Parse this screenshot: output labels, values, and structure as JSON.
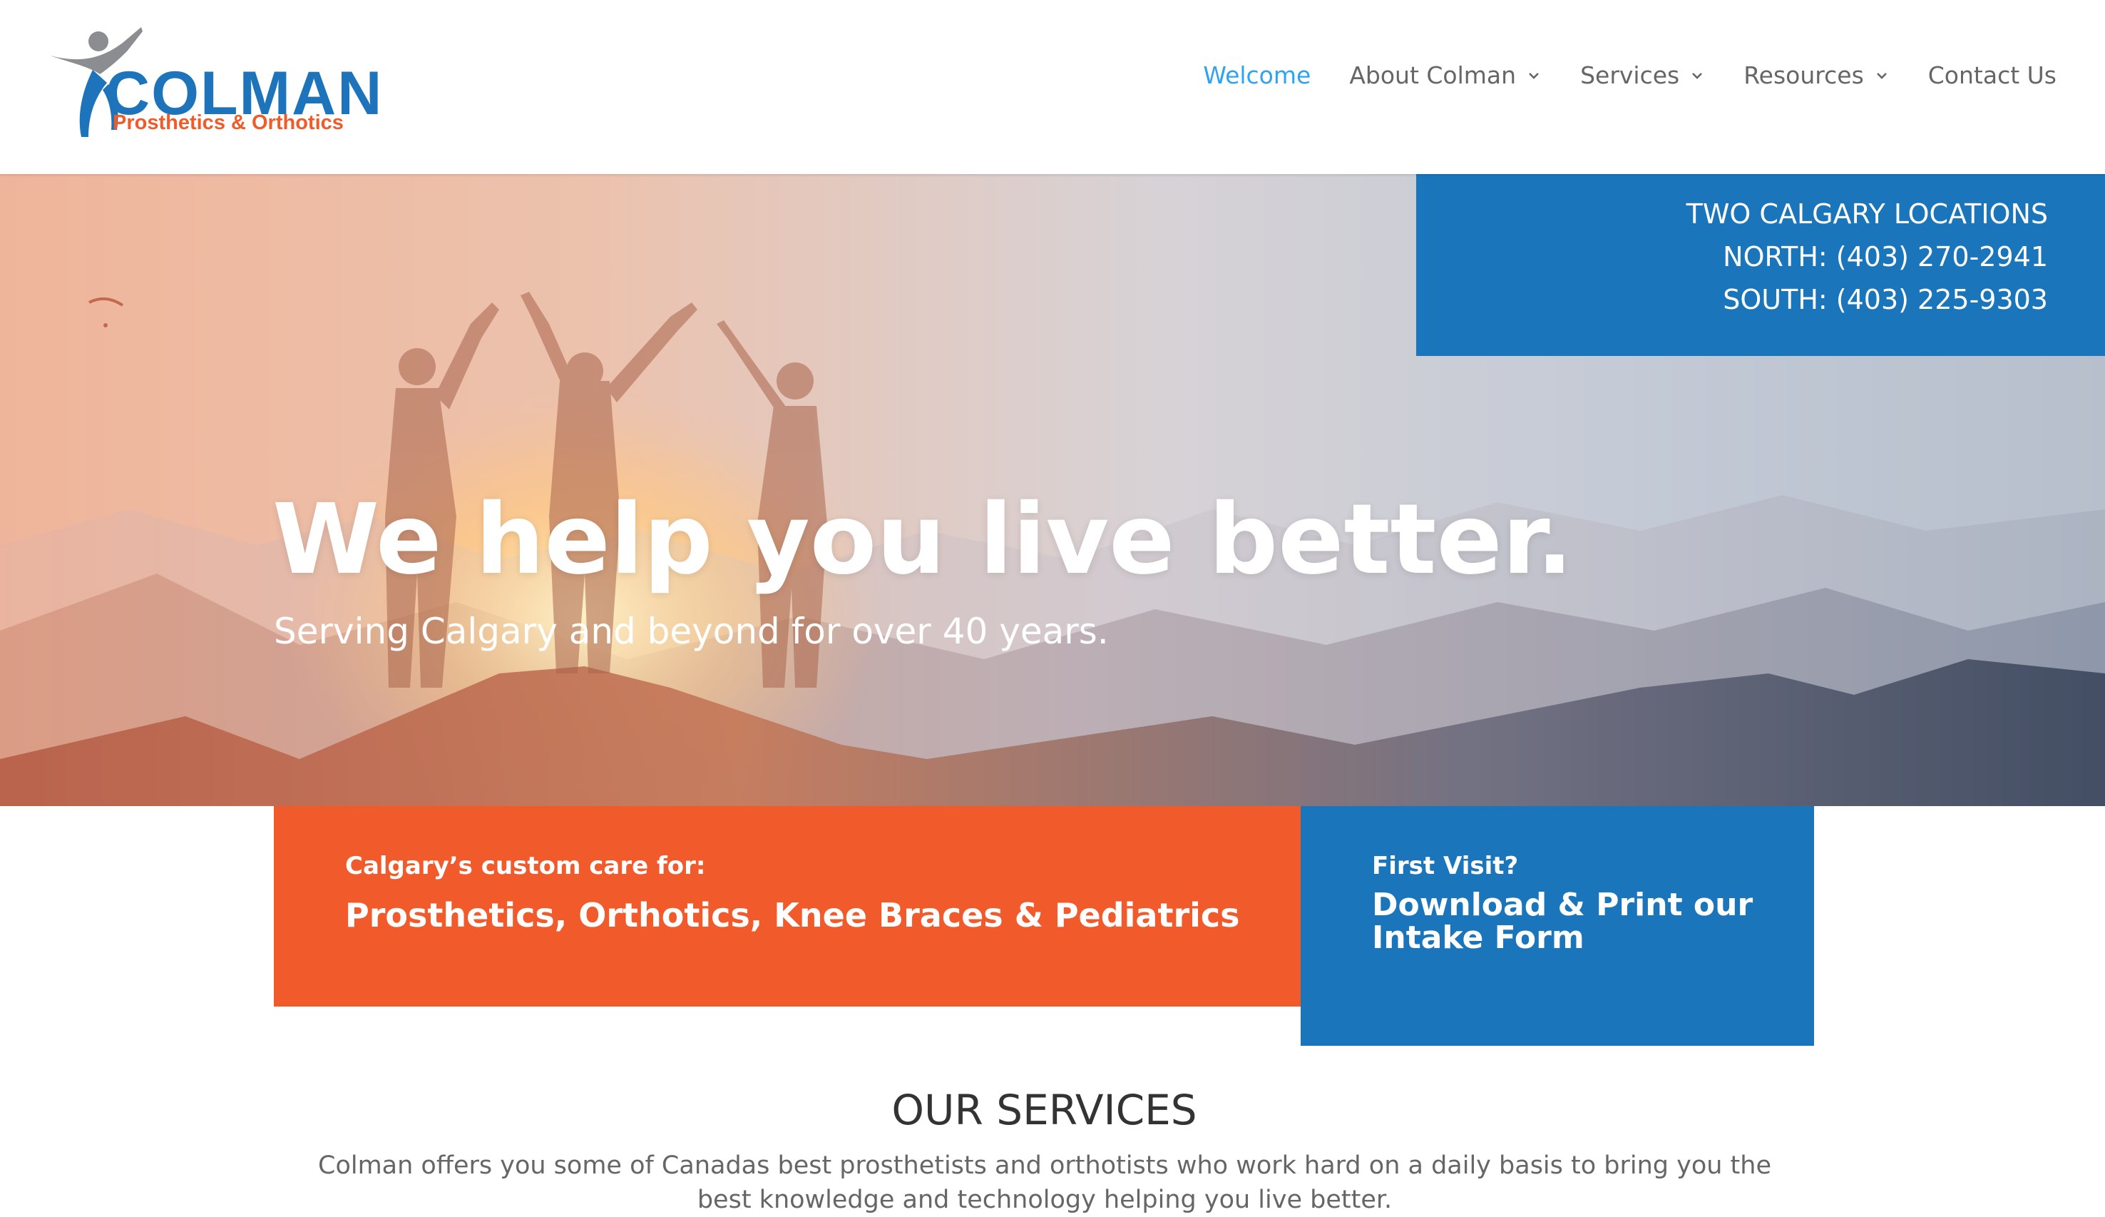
{
  "header": {
    "logo": {
      "wordmark": "COLMAN",
      "tagline": "Prosthetics & Orthotics"
    },
    "nav": [
      {
        "label": "Welcome",
        "active": true,
        "has_dropdown": false
      },
      {
        "label": "About Colman",
        "active": false,
        "has_dropdown": true
      },
      {
        "label": "Services",
        "active": false,
        "has_dropdown": true
      },
      {
        "label": "Resources",
        "active": false,
        "has_dropdown": true
      },
      {
        "label": "Contact Us",
        "active": false,
        "has_dropdown": false
      }
    ]
  },
  "hero": {
    "title": "We help you live better.",
    "subtitle": "Serving Calgary and beyond for over 40 years.",
    "locations": {
      "heading": "TWO CALGARY LOCATIONS",
      "north": "NORTH: (403) 270-2941",
      "south": "SOUTH: (403) 225-9303"
    }
  },
  "callouts": {
    "care": {
      "small": "Calgary’s custom care for:",
      "big": "Prosthetics, Orthotics, Knee Braces & Pediatrics"
    },
    "intake": {
      "small": "First Visit?",
      "big": "Download & Print our Intake Form"
    }
  },
  "services": {
    "title": "OUR SERVICES",
    "description": "Colman offers you some of Canadas best prosthetists and orthotists who work hard on a daily basis to bring you the best knowledge and technology helping you live better."
  },
  "colors": {
    "brand_blue": "#1b75bb",
    "brand_orange": "#f15a2b",
    "nav_active": "#2ea3f2",
    "nav_text": "#666666"
  },
  "icons": {
    "logo": "person-raising-arm-logo-icon",
    "nav_dropdown": "chevron-down-icon"
  }
}
